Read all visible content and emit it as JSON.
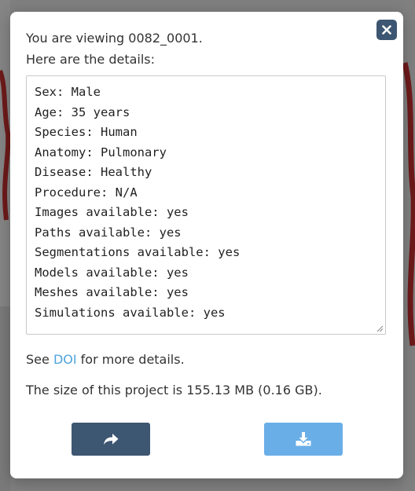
{
  "modal": {
    "intro_line1": "You are viewing 0082_0001.",
    "intro_line2": "Here are the details:",
    "details": [
      "Sex: Male",
      "Age: 35 years",
      "Species: Human",
      "Anatomy: Pulmonary",
      "Disease: Healthy",
      "Procedure: N/A",
      "Images available: yes",
      "Paths available: yes",
      "Segmentations available: yes",
      "Models available: yes",
      "Meshes available: yes",
      "Simulations available: yes"
    ],
    "doi_prefix": "See ",
    "doi_link": "DOI",
    "doi_suffix": " for more details.",
    "size_text": "The size of this project is 155.13 MB (0.16 GB).",
    "icons": {
      "close": "close-icon",
      "share": "share-arrow-icon",
      "download": "download-icon"
    }
  },
  "colors": {
    "primary_button": "#3d5671",
    "download_button": "#6aaee8",
    "link": "#4ea3dc",
    "overlay": "#7f7f7f"
  }
}
